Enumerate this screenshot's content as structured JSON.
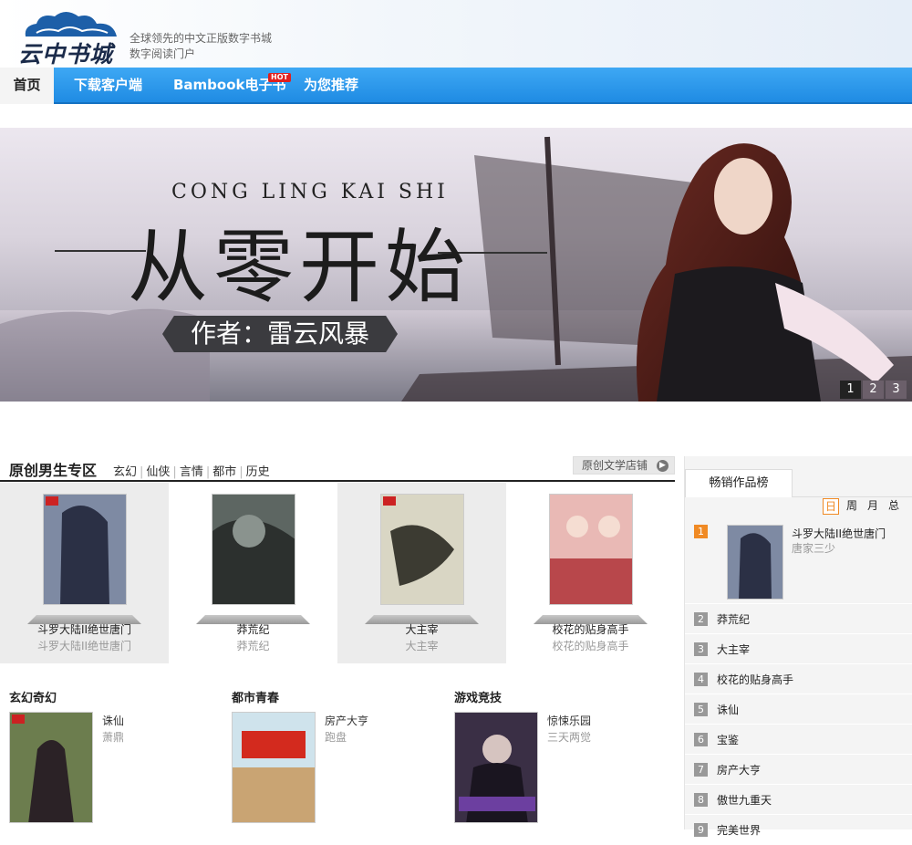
{
  "site": {
    "logo_text": "云中书城",
    "tagline_line1": "全球领先的中文正版数字书城",
    "tagline_line2": "数字阅读门户"
  },
  "nav": {
    "items": [
      {
        "label": "首页",
        "active": true
      },
      {
        "label": "下载客户端"
      },
      {
        "label": "Bambook电子书",
        "badge": "HOT"
      },
      {
        "label": "为您推荐"
      }
    ]
  },
  "banner": {
    "subtitle": "CONG LING KAI SHI",
    "title": "从零开始",
    "author": "作者：雷云风暴",
    "pages": [
      "1",
      "2",
      "3"
    ],
    "active_page": "1"
  },
  "original_male": {
    "title": "原创男生专区",
    "genres": [
      "玄幻",
      "仙侠",
      "言情",
      "都市",
      "历史"
    ],
    "store_link": "原创文学店铺",
    "books": [
      {
        "title": "斗罗大陆II绝世唐门",
        "author": "斗罗大陆II绝世唐门"
      },
      {
        "title": "莽荒纪",
        "author": "莽荒纪"
      },
      {
        "title": "大主宰",
        "author": "大主宰"
      },
      {
        "title": "校花的贴身高手",
        "author": "校花的贴身高手"
      }
    ]
  },
  "categories": [
    {
      "title": "玄幻奇幻",
      "book": "诛仙",
      "author": "萧鼎"
    },
    {
      "title": "都市青春",
      "book": "房产大亨",
      "author": "跑盘"
    },
    {
      "title": "游戏竞技",
      "book": "惊悚乐园",
      "author": "三天两觉"
    }
  ],
  "sidebar": {
    "tab": "畅销作品榜",
    "periods": [
      "日",
      "周",
      "月",
      "总"
    ],
    "active_period": "日",
    "top": {
      "rank": "1",
      "title": "斗罗大陆II绝世唐门",
      "author": "唐家三少"
    },
    "ranks": [
      {
        "rank": "2",
        "title": "莽荒纪"
      },
      {
        "rank": "3",
        "title": "大主宰"
      },
      {
        "rank": "4",
        "title": "校花的贴身高手"
      },
      {
        "rank": "5",
        "title": "诛仙"
      },
      {
        "rank": "6",
        "title": "宝鉴"
      },
      {
        "rank": "7",
        "title": "房产大亨"
      },
      {
        "rank": "8",
        "title": "傲世九重天"
      },
      {
        "rank": "9",
        "title": "完美世界"
      }
    ]
  },
  "colors": {
    "nav_blue": "#1f8be3",
    "accent_orange": "#f08a24",
    "hot_red": "#e0201e"
  }
}
